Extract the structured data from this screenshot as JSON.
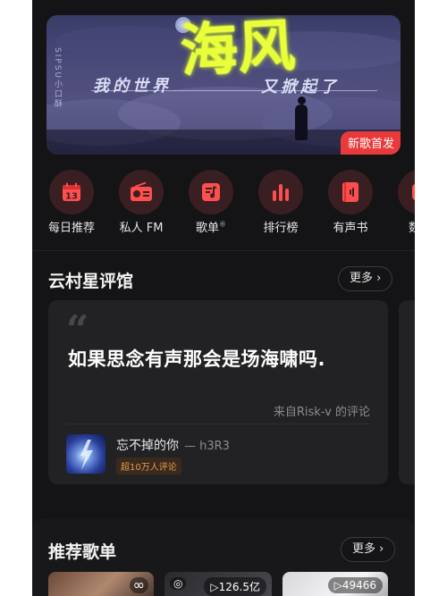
{
  "banner": {
    "vertical_text": "SIPSU小口酥",
    "title_big": "海风",
    "subtitle_left": "我的世界",
    "subtitle_right": "又掀起了",
    "tag": "新歌首发"
  },
  "quick_actions": [
    {
      "label": "每日推荐",
      "icon": "calendar-icon",
      "extra": "13"
    },
    {
      "label": "私人 FM",
      "icon": "radio-icon",
      "extra": ""
    },
    {
      "label": "歌单",
      "icon": "playlist-icon",
      "extra": "®"
    },
    {
      "label": "排行榜",
      "icon": "chart-bars-icon",
      "extra": ""
    },
    {
      "label": "有声书",
      "icon": "audiobook-icon",
      "extra": ""
    },
    {
      "label": "数字",
      "icon": "digital-icon",
      "extra": ""
    }
  ],
  "reviews_section": {
    "title": "云村星评馆",
    "more": "更多",
    "card": {
      "quote": "“",
      "text": "如果思念有声那会是场海啸吗.",
      "source": "来自Risk-v 的评论",
      "song_name": "忘不掉的你",
      "song_artist": "— h3R3",
      "badge": "超10万人评论"
    }
  },
  "playlists_section": {
    "title": "推荐歌单",
    "more": "更多",
    "playlists": [
      {
        "play_count": ""
      },
      {
        "play_count": "126.5亿"
      },
      {
        "play_count": "49466"
      }
    ]
  },
  "colors": {
    "background": "#141416",
    "card": "#222225",
    "accent_red": "#e83a3a",
    "icon_bg": "#3a1f22"
  }
}
